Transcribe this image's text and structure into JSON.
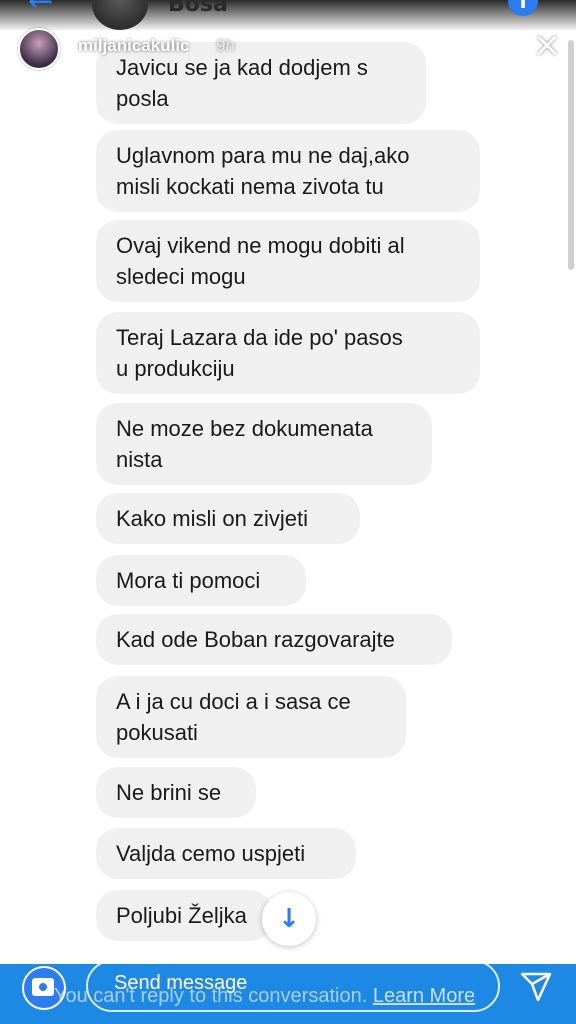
{
  "background_chat": {
    "contact_name": "Bosa"
  },
  "story": {
    "username": "miljanicakulic",
    "time": "9h"
  },
  "messages": [
    "Javicu se ja kad dodjem s\nposla",
    "Uglavnom para mu ne daj,ako\nmisli kockati nema zivota tu",
    "Ovaj vikend ne mogu dobiti al\nsledeci mogu",
    "Teraj Lazara da ide po' pasos\nu produkciju",
    "Ne moze bez dokumenata\nnista",
    "Kako misli on zivjeti",
    "Mora ti pomoci",
    "Kad ode Boban razgovarajte",
    "A i ja cu doci a i sasa ce\npokusati",
    "Ne brini se",
    "Valjda cemo uspjeti",
    "Poljubi Željka"
  ],
  "reply_bar": {
    "placeholder": "Send message",
    "notice": "You can't reply to this conversation.",
    "learn_more": "Learn More"
  },
  "colors": {
    "accent": "#2d7df0",
    "reply_bar": "#1e88e5",
    "bubble": "#f1f0f0"
  },
  "icons": [
    "back-arrow-icon",
    "info-icon",
    "close-icon",
    "camera-icon",
    "send-icon",
    "arrow-down-icon"
  ]
}
